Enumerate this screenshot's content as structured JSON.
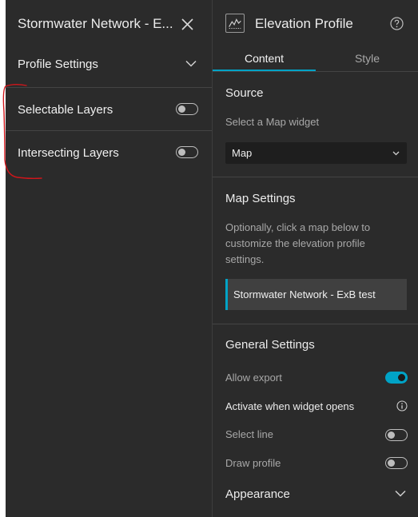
{
  "left_panel": {
    "title": "Stormwater Network - E...",
    "profile_settings_label": "Profile Settings",
    "selectable_layers_label": "Selectable Layers",
    "selectable_layers_enabled": false,
    "intersecting_layers_label": "Intersecting Layers",
    "intersecting_layers_enabled": false
  },
  "right_panel": {
    "title": "Elevation Profile",
    "tabs": [
      {
        "label": "Content",
        "active": true
      },
      {
        "label": "Style",
        "active": false
      }
    ],
    "source": {
      "heading": "Source",
      "select_map_label": "Select a Map widget",
      "map_select_value": "Map"
    },
    "map_settings": {
      "heading": "Map Settings",
      "description": "Optionally, click a map below to customize the elevation profile settings.",
      "map_item_label": "Stormwater Network - ExB test"
    },
    "general_settings": {
      "heading": "General Settings",
      "allow_export_label": "Allow export",
      "allow_export_enabled": true,
      "activate_label": "Activate when widget opens",
      "select_line_label": "Select line",
      "select_line_enabled": false,
      "draw_profile_label": "Draw profile",
      "draw_profile_enabled": false
    },
    "appearance_label": "Appearance"
  },
  "colors": {
    "panel_bg": "#2b2b2b",
    "accent": "#00a3c6",
    "annotation_red": "#d0161b"
  }
}
